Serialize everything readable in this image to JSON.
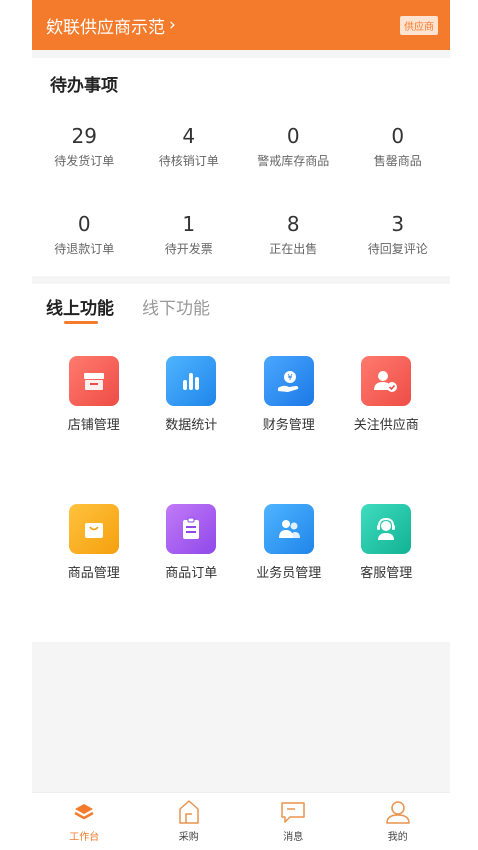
{
  "header": {
    "title": "欸联供应商示范",
    "badge": "供应商"
  },
  "todo": {
    "title": "待办事项",
    "items": [
      {
        "value": "29",
        "label": "待发货订单"
      },
      {
        "value": "4",
        "label": "待核销订单"
      },
      {
        "value": "0",
        "label": "警戒库存商品"
      },
      {
        "value": "0",
        "label": "售罄商品"
      },
      {
        "value": "0",
        "label": "待退款订单"
      },
      {
        "value": "1",
        "label": "待开发票"
      },
      {
        "value": "8",
        "label": "正在出售"
      },
      {
        "value": "3",
        "label": "待回复评论"
      }
    ]
  },
  "functions": {
    "tabs": [
      {
        "label": "线上功能"
      },
      {
        "label": "线下功能"
      }
    ],
    "items": [
      {
        "label": "店铺管理",
        "icon": "store-icon",
        "color": "#f25f57"
      },
      {
        "label": "数据统计",
        "icon": "bar-chart-icon",
        "color": "#2d9bf0"
      },
      {
        "label": "财务管理",
        "icon": "finance-icon",
        "color": "#2b8ef0"
      },
      {
        "label": "关注供应商",
        "icon": "follow-supplier-icon",
        "color": "#f25f57"
      },
      {
        "label": "商品管理",
        "icon": "shopping-bag-icon",
        "color": "#f5a623"
      },
      {
        "label": "商品订单",
        "icon": "clipboard-icon",
        "color": "#a55ef0"
      },
      {
        "label": "业务员管理",
        "icon": "salesman-icon",
        "color": "#2d9bf0"
      },
      {
        "label": "客服管理",
        "icon": "headset-icon",
        "color": "#23c4a4"
      }
    ]
  },
  "tabbar": {
    "items": [
      {
        "label": "工作台",
        "icon": "workbench-icon"
      },
      {
        "label": "采购",
        "icon": "purchase-icon"
      },
      {
        "label": "消息",
        "icon": "message-icon"
      },
      {
        "label": "我的",
        "icon": "profile-icon"
      }
    ]
  },
  "colors": {
    "accent": "#f57b2c"
  }
}
